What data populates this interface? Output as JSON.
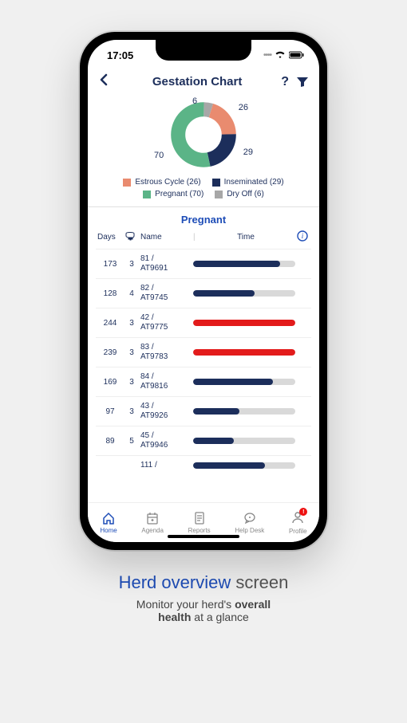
{
  "statusbar": {
    "time": "17:05"
  },
  "header": {
    "title": "Gestation Chart"
  },
  "chart_data": {
    "type": "pie",
    "title": "",
    "series": [
      {
        "name": "Estrous Cycle",
        "value": 26,
        "color": "#e98b6f"
      },
      {
        "name": "Inseminated",
        "value": 29,
        "color": "#1c2e5b"
      },
      {
        "name": "Pregnant",
        "value": 70,
        "color": "#5bb487"
      },
      {
        "name": "Dry Off",
        "value": 6,
        "color": "#a7a7a7"
      }
    ]
  },
  "legend": [
    {
      "label": "Estrous Cycle (26)",
      "color": "#e98b6f"
    },
    {
      "label": "Inseminated (29)",
      "color": "#1c2e5b"
    },
    {
      "label": "Pregnant (70)",
      "color": "#5bb487"
    },
    {
      "label": "Dry Off (6)",
      "color": "#a7a7a7"
    }
  ],
  "section": {
    "title": "Pregnant"
  },
  "columns": {
    "days": "Days",
    "name": "Name",
    "time": "Time"
  },
  "rows": [
    {
      "days": "173",
      "count": "3",
      "name_line1": "81 /",
      "name_line2": "AT9691",
      "barColor": "#1c2e5b",
      "barPct": 85
    },
    {
      "days": "128",
      "count": "4",
      "name_line1": "82 /",
      "name_line2": "AT9745",
      "barColor": "#1c2e5b",
      "barPct": 60
    },
    {
      "days": "244",
      "count": "3",
      "name_line1": "42 /",
      "name_line2": "AT9775",
      "barColor": "#e31b1b",
      "barPct": 100
    },
    {
      "days": "239",
      "count": "3",
      "name_line1": "83 /",
      "name_line2": "AT9783",
      "barColor": "#e31b1b",
      "barPct": 100
    },
    {
      "days": "169",
      "count": "3",
      "name_line1": "84 /",
      "name_line2": "AT9816",
      "barColor": "#1c2e5b",
      "barPct": 78
    },
    {
      "days": "97",
      "count": "3",
      "name_line1": "43 /",
      "name_line2": "AT9926",
      "barColor": "#1c2e5b",
      "barPct": 45
    },
    {
      "days": "89",
      "count": "5",
      "name_line1": "45 /",
      "name_line2": "AT9946",
      "barColor": "#1c2e5b",
      "barPct": 40
    },
    {
      "days": "",
      "count": "",
      "name_line1": "111 /",
      "name_line2": "",
      "barColor": "#1c2e5b",
      "barPct": 70
    }
  ],
  "nav": [
    {
      "label": "Home",
      "active": true
    },
    {
      "label": "Agenda",
      "active": false
    },
    {
      "label": "Reports",
      "active": false
    },
    {
      "label": "Help Desk",
      "active": false
    },
    {
      "label": "Profile",
      "active": false,
      "badge": true
    }
  ],
  "caption": {
    "title_accent": "Herd overview",
    "title_rest": " screen",
    "sub_pre": "Monitor your herd's ",
    "sub_bold1": "overall",
    "sub_mid": " ",
    "sub_bold2": "health",
    "sub_post": " at a glance"
  }
}
